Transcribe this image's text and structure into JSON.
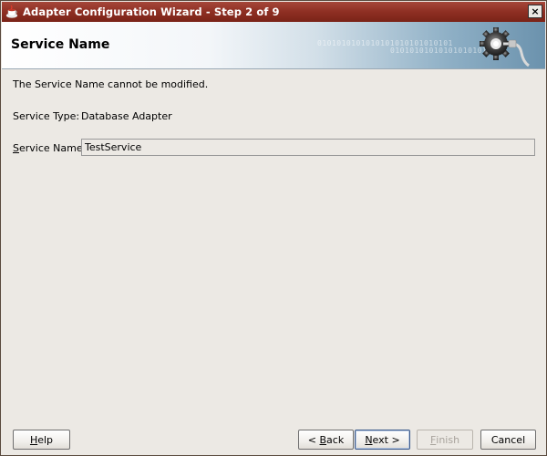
{
  "window": {
    "title": "Adapter Configuration Wizard - Step 2 of 9",
    "close_glyph": "×"
  },
  "banner": {
    "title": "Service Name",
    "binary_line1": "0101010101010101010101010101",
    "binary_line2": "0101010101010101010101"
  },
  "content": {
    "info_text": "The Service Name cannot be modified.",
    "service_type_label": "Service Type:",
    "service_type_value": "Database Adapter",
    "service_name_label_mnemonic": "S",
    "service_name_label_rest": "ervice Name:",
    "service_name_value": "TestService"
  },
  "buttons": {
    "help_mnemonic": "H",
    "help_rest": "elp",
    "back_prefix": "< ",
    "back_mnemonic": "B",
    "back_rest": "ack",
    "next_mnemonic": "N",
    "next_rest": "ext >",
    "finish_mnemonic": "F",
    "finish_rest": "inish",
    "cancel": "Cancel"
  },
  "colors": {
    "titlebar": "#8e2f23",
    "dialog_bg": "#ece9e4",
    "default_button_border": "#3c5a8a"
  },
  "icons": {
    "title_icon": "java-coffee-cup-icon",
    "banner_icon": "gear-plug-icon",
    "close": "close-icon"
  }
}
